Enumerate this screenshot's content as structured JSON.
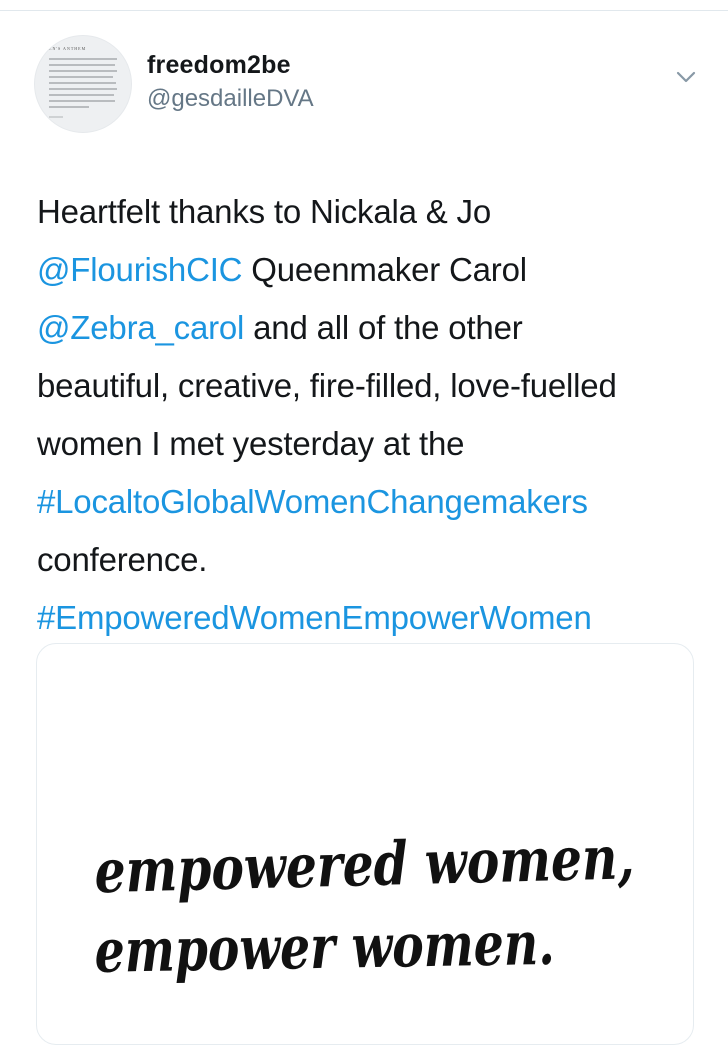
{
  "tweet": {
    "author": {
      "name": "freedom2be",
      "handle": "@gesdailleDVA",
      "avatar_title": "EN'S ANTHEM"
    },
    "text_lines": [
      [
        {
          "text": "Heartfelt thanks to Nickala & Jo",
          "link": false
        }
      ],
      [
        {
          "text": "@FlourishCIC",
          "link": true
        },
        {
          "text": " Queenmaker Carol",
          "link": false
        }
      ],
      [
        {
          "text": "@Zebra_carol",
          "link": true
        },
        {
          "text": " and all of the other",
          "link": false
        }
      ],
      [
        {
          "text": "beautiful, creative, fire-filled, love-fuelled",
          "link": false
        }
      ],
      [
        {
          "text": "women I met yesterday at the",
          "link": false
        }
      ],
      [
        {
          "text": "#LocaltoGlobalWomenChangemakers",
          "link": true
        }
      ],
      [
        {
          "text": "conference.",
          "link": false
        }
      ],
      [
        {
          "text": "#EmpoweredWomenEmpowerWomen",
          "link": true
        }
      ]
    ],
    "media": {
      "line1": "empowered women,",
      "line2": "empower women."
    }
  },
  "colors": {
    "text": "#14171a",
    "link": "#1b95e0",
    "secondary": "#657786",
    "border": "#e6ecf0"
  },
  "icons": {
    "more": "chevron-down-icon"
  }
}
